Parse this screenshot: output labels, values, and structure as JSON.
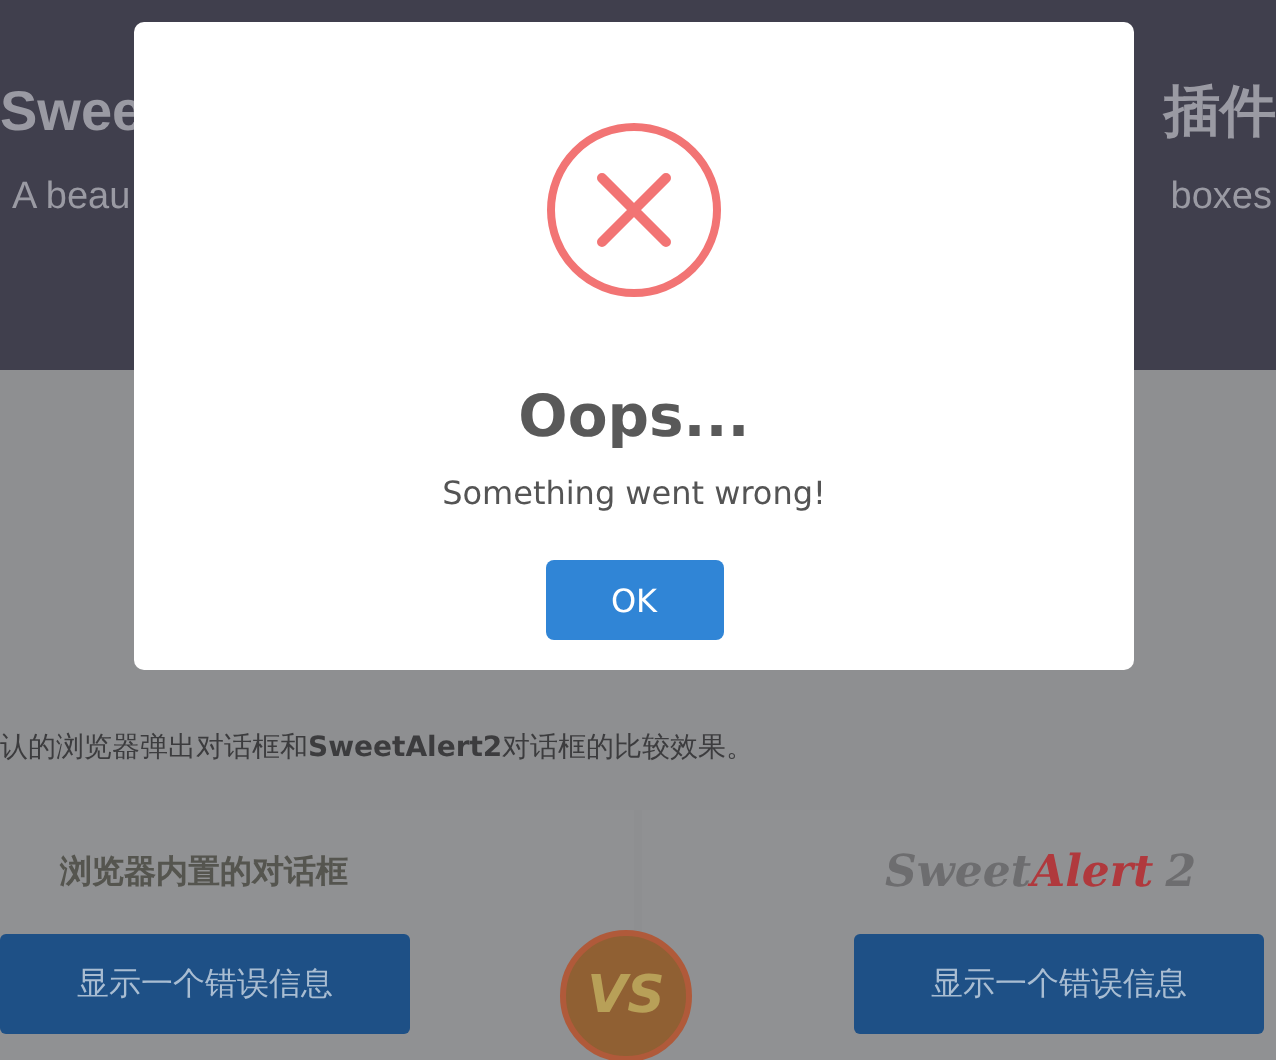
{
  "header": {
    "title_left": "Swee",
    "title_right": "插件",
    "subtitle_left": "A beau",
    "subtitle_right": "boxes"
  },
  "intro": "认的浏览器弹出对话框和**SweetAlert2**对话框的比较效果。",
  "panels": [
    {
      "kind": "heading",
      "heading": "浏览器内置的对话框",
      "button": "显示一个错误信息"
    },
    {
      "kind": "logo",
      "logo": [
        "Sweet",
        "Alert",
        "2"
      ],
      "button": "显示一个错误信息"
    }
  ],
  "vs_badge": "VS",
  "dialog": {
    "kind": "error",
    "title": "Oops...",
    "message": "Something went wrong!",
    "button": "OK"
  }
}
